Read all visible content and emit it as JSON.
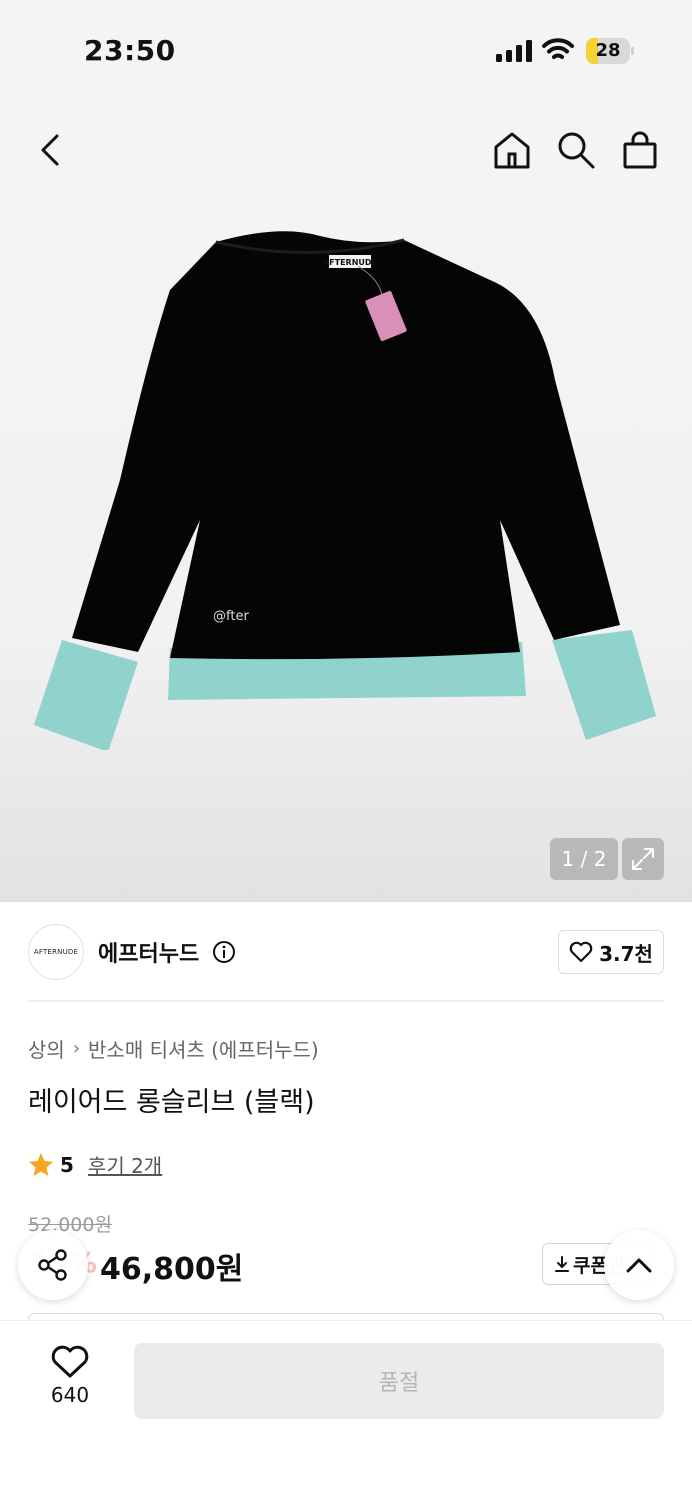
{
  "status_bar": {
    "time": "23:50",
    "battery": "28",
    "battery_level": 0.28
  },
  "hero": {
    "image_counter": "1 / 2",
    "product_image_text": {
      "neck_label": "AFTERNUDE",
      "embroidery": "@fter"
    }
  },
  "icons": {
    "back": "chevron-left-icon",
    "home": "home-icon",
    "search": "search-icon",
    "cart": "shopping-bag-icon",
    "expand": "expand-icon",
    "info": "info-icon",
    "heart": "heart-icon",
    "star": "star-icon",
    "share": "share-icon",
    "scroll_top": "chevron-up-icon",
    "download": "download-icon"
  },
  "brand": {
    "logo_text": "AFTERNUDE",
    "name": "에프터누드",
    "likes": "3.7천"
  },
  "breadcrumb": {
    "category": "상의",
    "subcategory": "반소매 티셔츠 (에프터누드)"
  },
  "product": {
    "title": "레이어드 롱슬리브 (블랙)",
    "rating": "5",
    "reviews": "후기 2개",
    "original_price": "52,000원",
    "discount": "10%",
    "sale_price": "46,800원",
    "coupon_label": "쿠폰",
    "coupon_suffix": "받기"
  },
  "bottom_bar": {
    "wish_count": "640",
    "cta_label": "품절"
  },
  "colors": {
    "accent_star": "#f5a623",
    "sleeve_mint": "#8fd3cc",
    "discount_red": "#f2524b",
    "tag_pink": "#d98fb8"
  }
}
